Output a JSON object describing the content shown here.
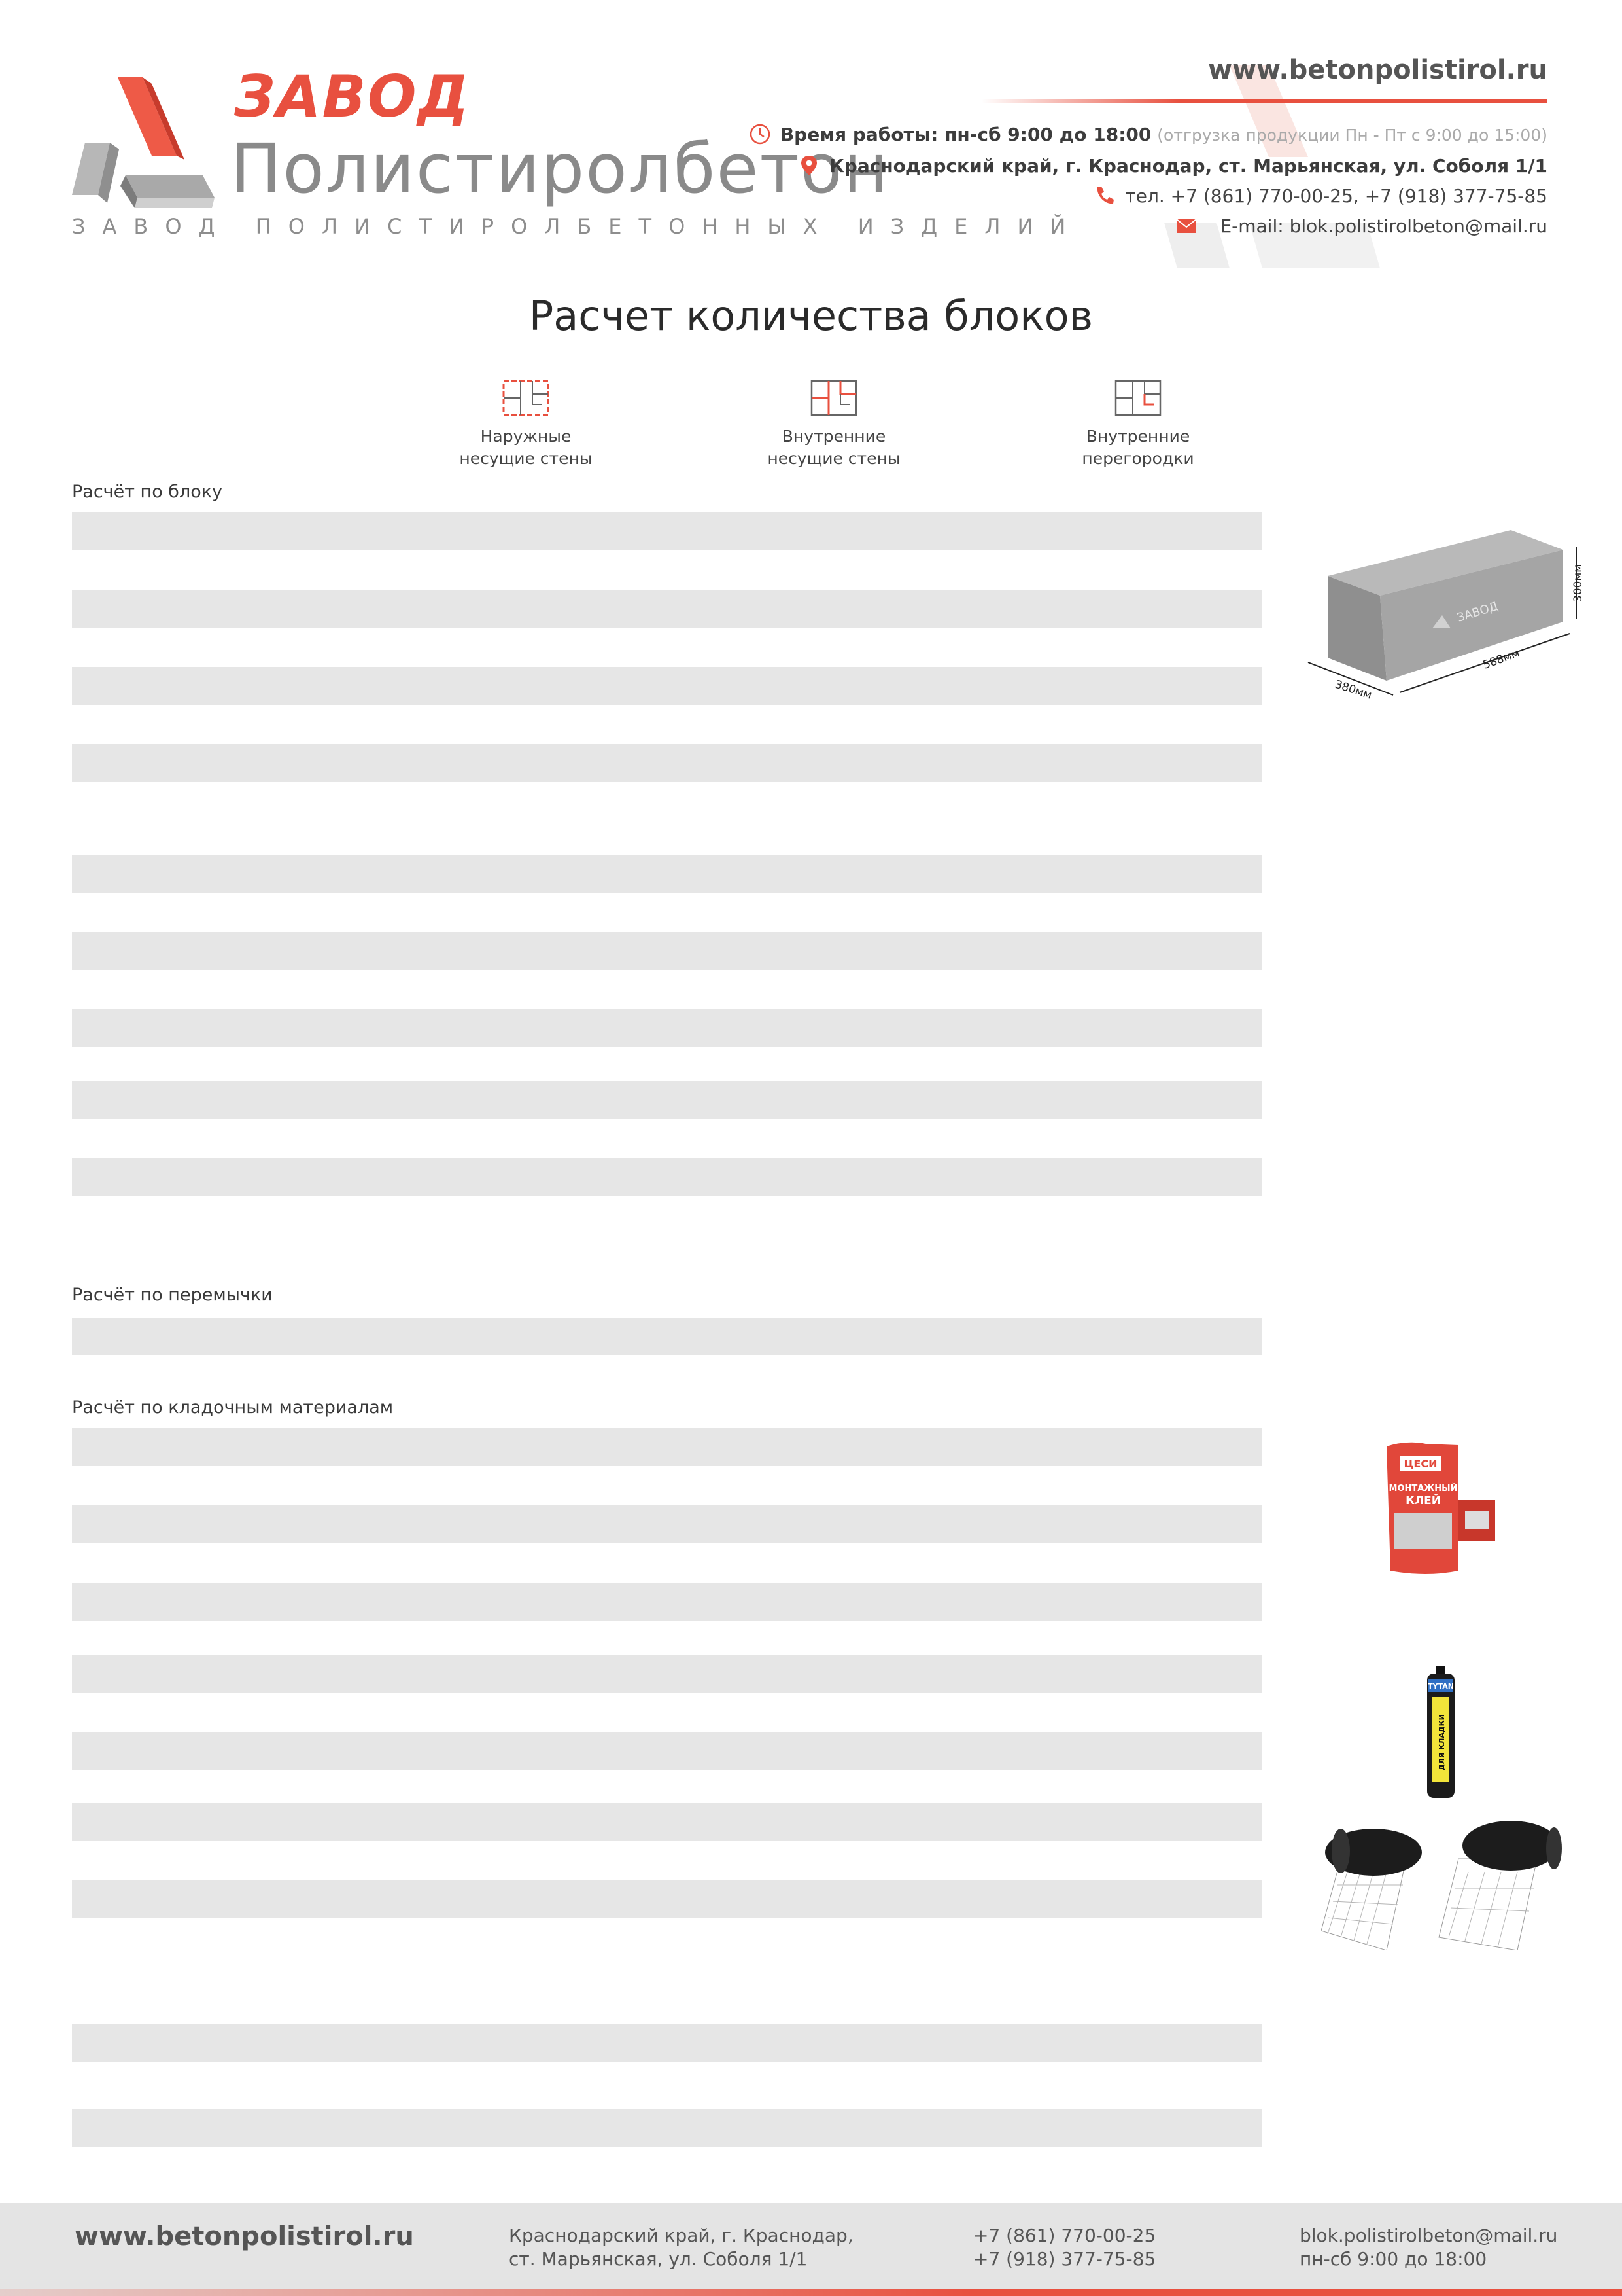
{
  "header": {
    "brand": "ЗАВОД",
    "name": "Полистиролбетон",
    "tagline": "ЗАВОД ПОЛИСТИРОЛБЕТОННЫХ ИЗДЕЛИЙ",
    "site": "www.betonpolistirol.ru",
    "hours_label": "Время работы: пн-сб 9:00 до 18:00",
    "hours_note": "(отгрузка продукции Пн - Пт с 9:00 до 15:00)",
    "address": "Краснодарский край, г. Краснодар, ст. Марьянская, ул. Соболя 1/1",
    "phone": "тел. +7 (861) 770-00-25, +7 (918) 377-75-85",
    "email": "E-mail: blok.polistirolbeton@mail.ru"
  },
  "page_title": "Расчет количества блоков",
  "tabs": [
    {
      "line1": "Наружные",
      "line2": "несущие стены"
    },
    {
      "line1": "Внутренние",
      "line2": "несущие стены"
    },
    {
      "line1": "Внутренние",
      "line2": "перегородки"
    }
  ],
  "sections": {
    "block": "Расчёт по блоку",
    "lintel": "Расчёт по перемычки",
    "masonry": "Расчёт по кладочным материалам"
  },
  "block_image": {
    "label": "ЗАВОД",
    "dim_w": "380мм",
    "dim_l": "588мм",
    "dim_h": "300мм"
  },
  "products": {
    "glue_brand": "ЦЕСИ",
    "glue_label1": "МОНТАЖНЫЙ",
    "glue_label2": "КЛЕЙ",
    "foam_brand": "TYTAN",
    "foam_label": "ДЛЯ КЛАДКИ"
  },
  "footer": {
    "site": "www.betonpolistirol.ru",
    "address1": "Краснодарский край, г. Краснодар,",
    "address2": "ст. Марьянская, ул. Соболя 1/1",
    "phone1": "+7 (861) 770-00-25",
    "phone2": "+7 (918) 377-75-85",
    "email": "blok.polistirolbeton@mail.ru",
    "hours": "пн-сб 9:00 до 18:00"
  },
  "colors": {
    "accent": "#e8503f",
    "bar": "#e6e6e6",
    "footer_bg": "#e4e4e4"
  }
}
